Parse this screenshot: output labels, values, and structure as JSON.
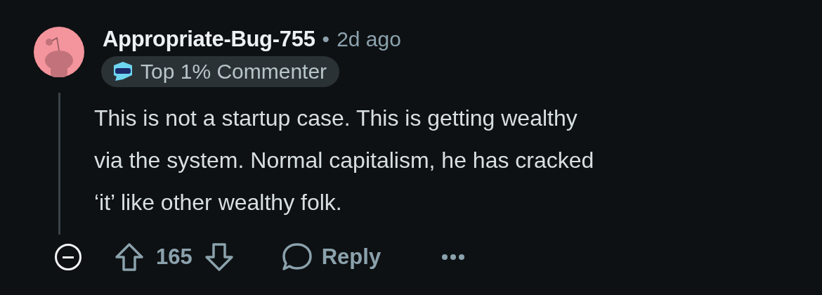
{
  "comment": {
    "author": "Appropriate-Bug-755",
    "separator": "•",
    "time": "2d ago",
    "badge": "Top 1% Commenter",
    "body": "This is not a startup case. This is getting wealthy\nvia the system. Normal capitalism, he has cracked\n‘it’ like other wealthy folk.",
    "score": "165",
    "reply_label": "Reply",
    "collapsed": false
  }
}
